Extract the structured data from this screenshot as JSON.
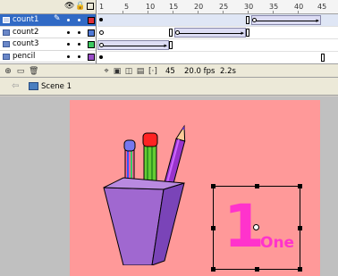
{
  "timeline": {
    "layers": [
      {
        "name": "count1",
        "selected": true,
        "color": "#e0303a"
      },
      {
        "name": "count2",
        "selected": false,
        "color": "#4f79d6"
      },
      {
        "name": "count3",
        "selected": false,
        "color": "#3cc860"
      },
      {
        "name": "pencil",
        "selected": false,
        "color": "#9a4dc8"
      }
    ],
    "ruler_labels": [
      "1",
      "5",
      "10",
      "15",
      "20",
      "25",
      "30",
      "35",
      "40",
      "45"
    ],
    "current_frame": "45",
    "fps": "20.0 fps",
    "elapsed": "2.2s"
  },
  "editbar": {
    "scene_label": "Scene 1"
  },
  "stage": {
    "big_digit": "1",
    "word": "One",
    "background": "#ff9999",
    "text_color": "#ff33cc"
  },
  "icons": [
    "eye-icon",
    "lock-icon",
    "outline-icon",
    "pencil-icon",
    "layer-icon",
    "insert-layer-icon",
    "add-folder-icon",
    "delete-layer-icon",
    "center-frame-icon",
    "onion-skin-icon",
    "onion-outline-icon",
    "edit-multiple-icon",
    "onion-markers-icon",
    "back-icon",
    "scene-icon"
  ]
}
